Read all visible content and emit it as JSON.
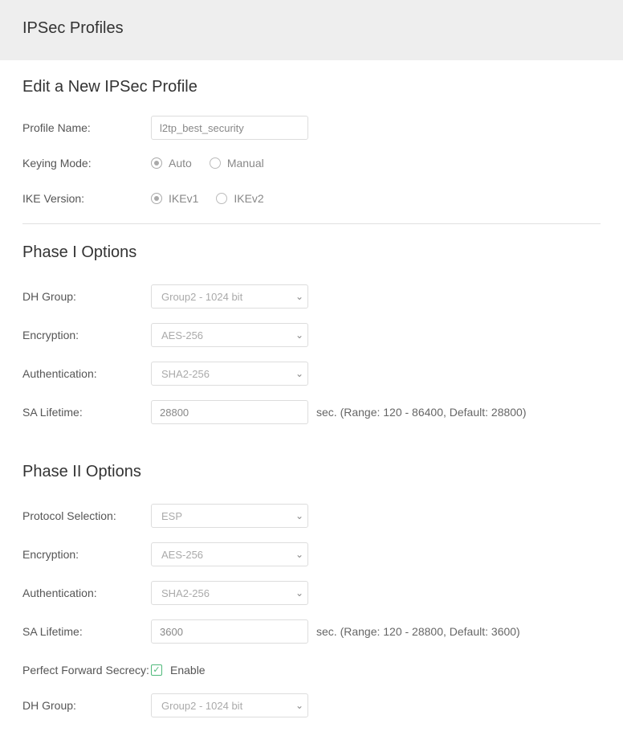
{
  "header": {
    "title": "IPSec Profiles"
  },
  "edit": {
    "title": "Edit a New IPSec Profile"
  },
  "profile": {
    "name_label": "Profile Name:",
    "name_value": "l2tp_best_security",
    "keying_label": "Keying Mode:",
    "keying_options": {
      "auto": "Auto",
      "manual": "Manual"
    },
    "keying_selected": "auto",
    "ike_label": "IKE Version:",
    "ike_options": {
      "v1": "IKEv1",
      "v2": "IKEv2"
    },
    "ike_selected": "v1"
  },
  "phase1": {
    "title": "Phase I Options",
    "dh_label": "DH Group:",
    "dh_value": "Group2 - 1024 bit",
    "enc_label": "Encryption:",
    "enc_value": "AES-256",
    "auth_label": "Authentication:",
    "auth_value": "SHA2-256",
    "sa_label": "SA Lifetime:",
    "sa_value": "28800",
    "sa_hint": "sec. (Range: 120 - 86400, Default: 28800)"
  },
  "phase2": {
    "title": "Phase II Options",
    "proto_label": "Protocol Selection:",
    "proto_value": "ESP",
    "enc_label": "Encryption:",
    "enc_value": "AES-256",
    "auth_label": "Authentication:",
    "auth_value": "SHA2-256",
    "sa_label": "SA Lifetime:",
    "sa_value": "3600",
    "sa_hint": "sec. (Range: 120 - 28800, Default: 3600)",
    "pfs_label": "Perfect Forward Secrecy:",
    "pfs_enable": "Enable",
    "pfs_checked": true,
    "dh_label": "DH Group:",
    "dh_value": "Group2 - 1024 bit"
  }
}
